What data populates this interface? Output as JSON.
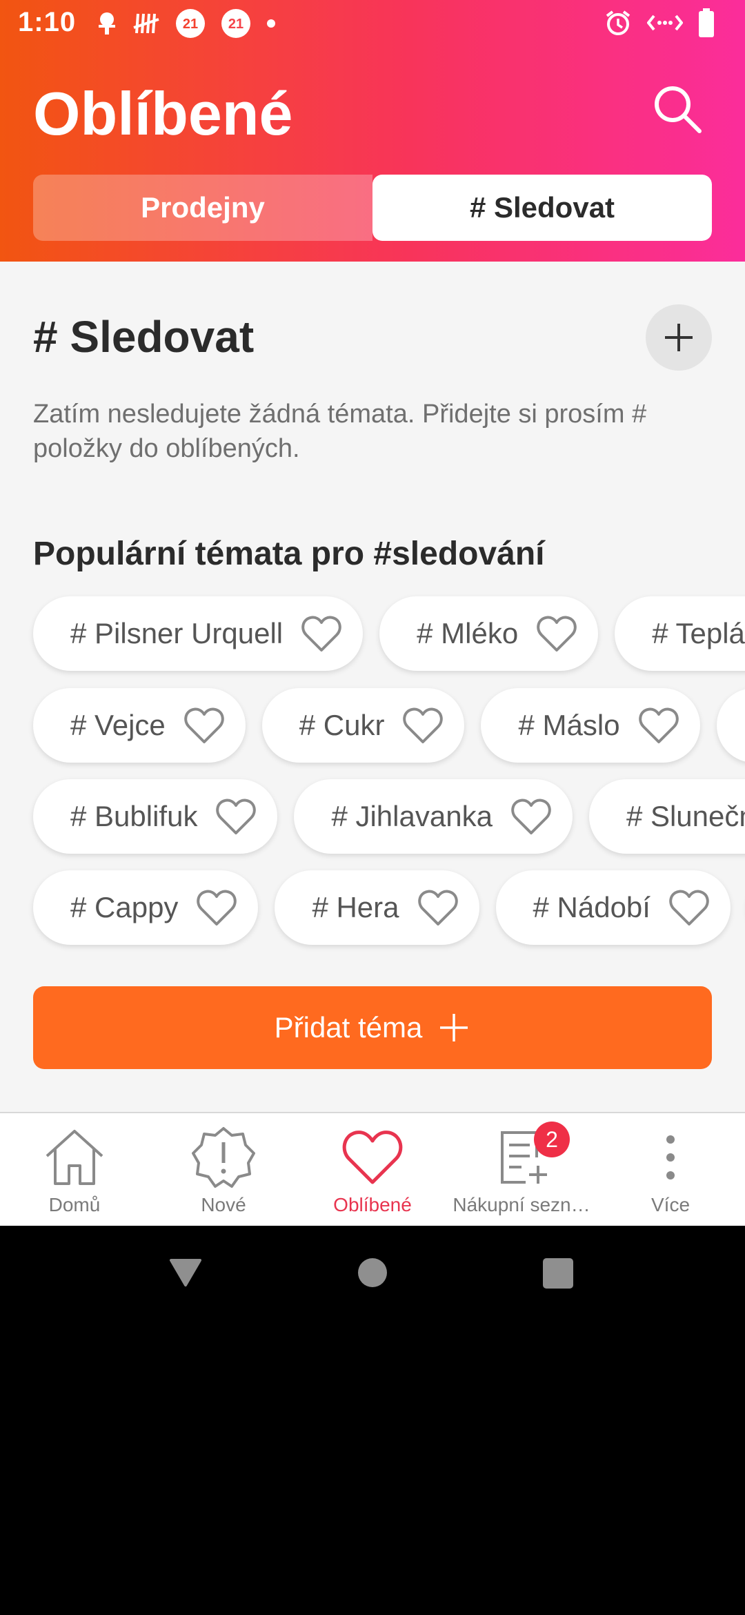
{
  "status_bar": {
    "time": "1:10",
    "left_icons": [
      "bug-icon",
      "tally-icon",
      "badge-21-icon",
      "badge-21-icon",
      "dot-icon"
    ],
    "badge_text": "21",
    "right_icons": [
      "alarm-icon",
      "data-saver-icon",
      "battery-icon"
    ]
  },
  "header": {
    "title": "Oblíbené",
    "tabs": [
      {
        "label": "Prodejny",
        "selected": false
      },
      {
        "label": "# Sledovat",
        "selected": true
      }
    ],
    "gradient": [
      "#f25511",
      "#fb2d9b"
    ]
  },
  "main": {
    "section_title": "# Sledovat",
    "empty_message": "Zatím nesledujete žádná témata. Přidejte si prosím # položky do oblíbených.",
    "popular_title": "Populární témata pro #sledování",
    "chip_rows": [
      [
        "# Pilsner Urquell",
        "# Mléko",
        "# Teplá"
      ],
      [
        "# Vejce",
        "# Cukr",
        "# Máslo",
        ""
      ],
      [
        "# Bublifuk",
        "# Jihlavanka",
        "# Slunečn"
      ],
      [
        "# Cappy",
        "# Hera",
        "# Nádobí",
        ""
      ]
    ],
    "cta_label": "Přidat téma",
    "accent_color": "#ff6a1f"
  },
  "bottom_nav": {
    "items": [
      {
        "label": "Domů",
        "icon": "home-icon",
        "active": false
      },
      {
        "label": "Nové",
        "icon": "new-badge-icon",
        "active": false
      },
      {
        "label": "Oblíbené",
        "icon": "heart-icon",
        "active": true
      },
      {
        "label": "Nákupní sezn…",
        "icon": "shopping-list-icon",
        "active": false,
        "badge": "2"
      },
      {
        "label": "Více",
        "icon": "more-vertical-icon",
        "active": false
      }
    ],
    "active_color": "#e8344f"
  },
  "system_nav": [
    "back-icon",
    "home-circle-icon",
    "recents-icon"
  ]
}
